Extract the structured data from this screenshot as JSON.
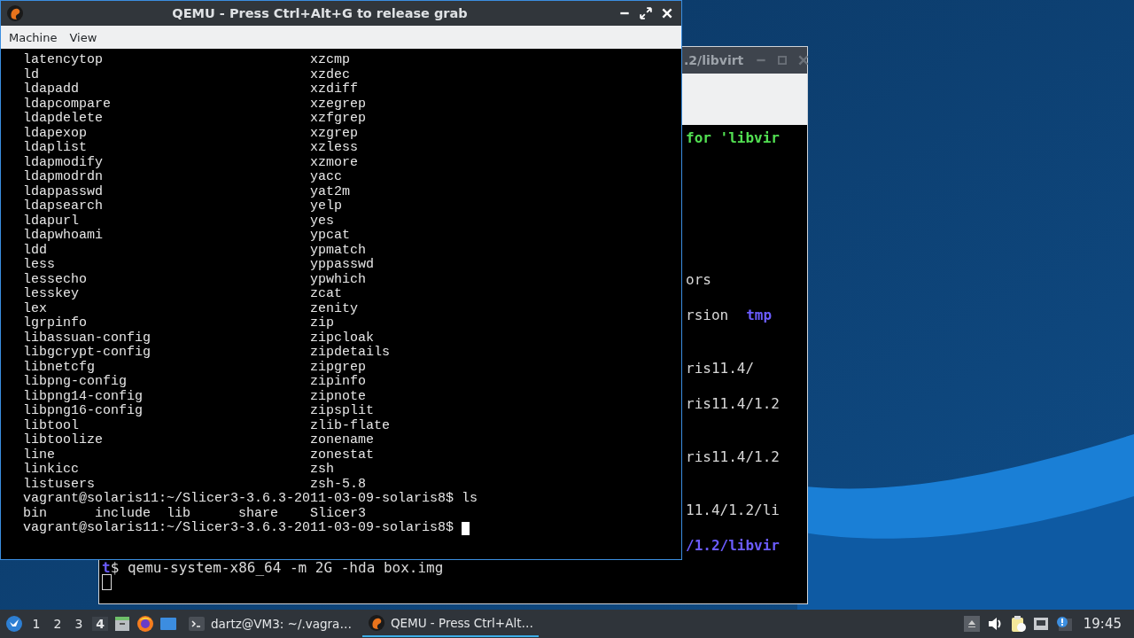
{
  "qemu_window": {
    "title": "QEMU - Press Ctrl+Alt+G to release grab",
    "menu": [
      {
        "label": "Machine"
      },
      {
        "label": "View"
      }
    ],
    "listing": [
      {
        "left": "latencytop",
        "right": "xzcmp"
      },
      {
        "left": "ld",
        "right": "xzdec"
      },
      {
        "left": "ldapadd",
        "right": "xzdiff"
      },
      {
        "left": "ldapcompare",
        "right": "xzegrep"
      },
      {
        "left": "ldapdelete",
        "right": "xzfgrep"
      },
      {
        "left": "ldapexop",
        "right": "xzgrep"
      },
      {
        "left": "ldaplist",
        "right": "xzless"
      },
      {
        "left": "ldapmodify",
        "right": "xzmore"
      },
      {
        "left": "ldapmodrdn",
        "right": "yacc"
      },
      {
        "left": "ldappasswd",
        "right": "yat2m"
      },
      {
        "left": "ldapsearch",
        "right": "yelp"
      },
      {
        "left": "ldapurl",
        "right": "yes"
      },
      {
        "left": "ldapwhoami",
        "right": "ypcat"
      },
      {
        "left": "ldd",
        "right": "ypmatch"
      },
      {
        "left": "less",
        "right": "yppasswd"
      },
      {
        "left": "lessecho",
        "right": "ypwhich"
      },
      {
        "left": "lesskey",
        "right": "zcat"
      },
      {
        "left": "lex",
        "right": "zenity"
      },
      {
        "left": "lgrpinfo",
        "right": "zip"
      },
      {
        "left": "libassuan-config",
        "right": "zipcloak"
      },
      {
        "left": "libgcrypt-config",
        "right": "zipdetails"
      },
      {
        "left": "libnetcfg",
        "right": "zipgrep"
      },
      {
        "left": "libpng-config",
        "right": "zipinfo"
      },
      {
        "left": "libpng14-config",
        "right": "zipnote"
      },
      {
        "left": "libpng16-config",
        "right": "zipsplit"
      },
      {
        "left": "libtool",
        "right": "zlib-flate"
      },
      {
        "left": "libtoolize",
        "right": "zonename"
      },
      {
        "left": "line",
        "right": "zonestat"
      },
      {
        "left": "linkicc",
        "right": "zsh"
      },
      {
        "left": "listusers",
        "right": "zsh-5.8"
      }
    ],
    "command": "vagrant@solaris11:~/Slicer3-3.6.3-2011-03-09-solaris8$ ls",
    "ls_output": [
      "bin",
      "include",
      "lib",
      "share",
      "Slicer3"
    ],
    "prompt": "vagrant@solaris11:~/Slicer3-3.6.3-2011-03-09-solaris8$"
  },
  "background_terminal": {
    "title": ".2/libvirt",
    "tail_lines": [
      [
        {
          "text": "for 'libvir",
          "kind": "heading"
        }
      ],
      [
        {
          "text": "ors",
          "kind": "plain"
        }
      ],
      [
        {
          "text": "rsion",
          "kind": "plain"
        },
        {
          "text": "tmp",
          "kind": "directory"
        }
      ],
      [
        {
          "text": "ris11.4/",
          "kind": "plain"
        }
      ],
      [
        {
          "text": "ris11.4/1.2",
          "kind": "plain"
        }
      ],
      [
        {
          "text": "ris11.4/1.2",
          "kind": "plain"
        }
      ],
      [
        {
          "text": "11.4/1.2/li",
          "kind": "plain"
        }
      ],
      [
        {
          "text": "/1.2/libvir",
          "kind": "directory"
        }
      ]
    ],
    "command_line": [
      {
        "text": "t",
        "kind": "directory"
      },
      {
        "text": "$ qemu-system-x86_64 -m 2G -hda box.img",
        "kind": "plain"
      }
    ]
  },
  "taskbar": {
    "workspaces": [
      {
        "label": "1",
        "selected": false
      },
      {
        "label": "2",
        "selected": false
      },
      {
        "label": "3",
        "selected": false
      },
      {
        "label": "4",
        "selected": true
      }
    ],
    "tasks": [
      {
        "label": "dartz@VM3: ~/.vagra…",
        "kind": "terminal",
        "selected": false
      },
      {
        "label": "QEMU - Press Ctrl+Alt…",
        "kind": "qemu",
        "selected": true
      }
    ],
    "clock": "19:45"
  }
}
